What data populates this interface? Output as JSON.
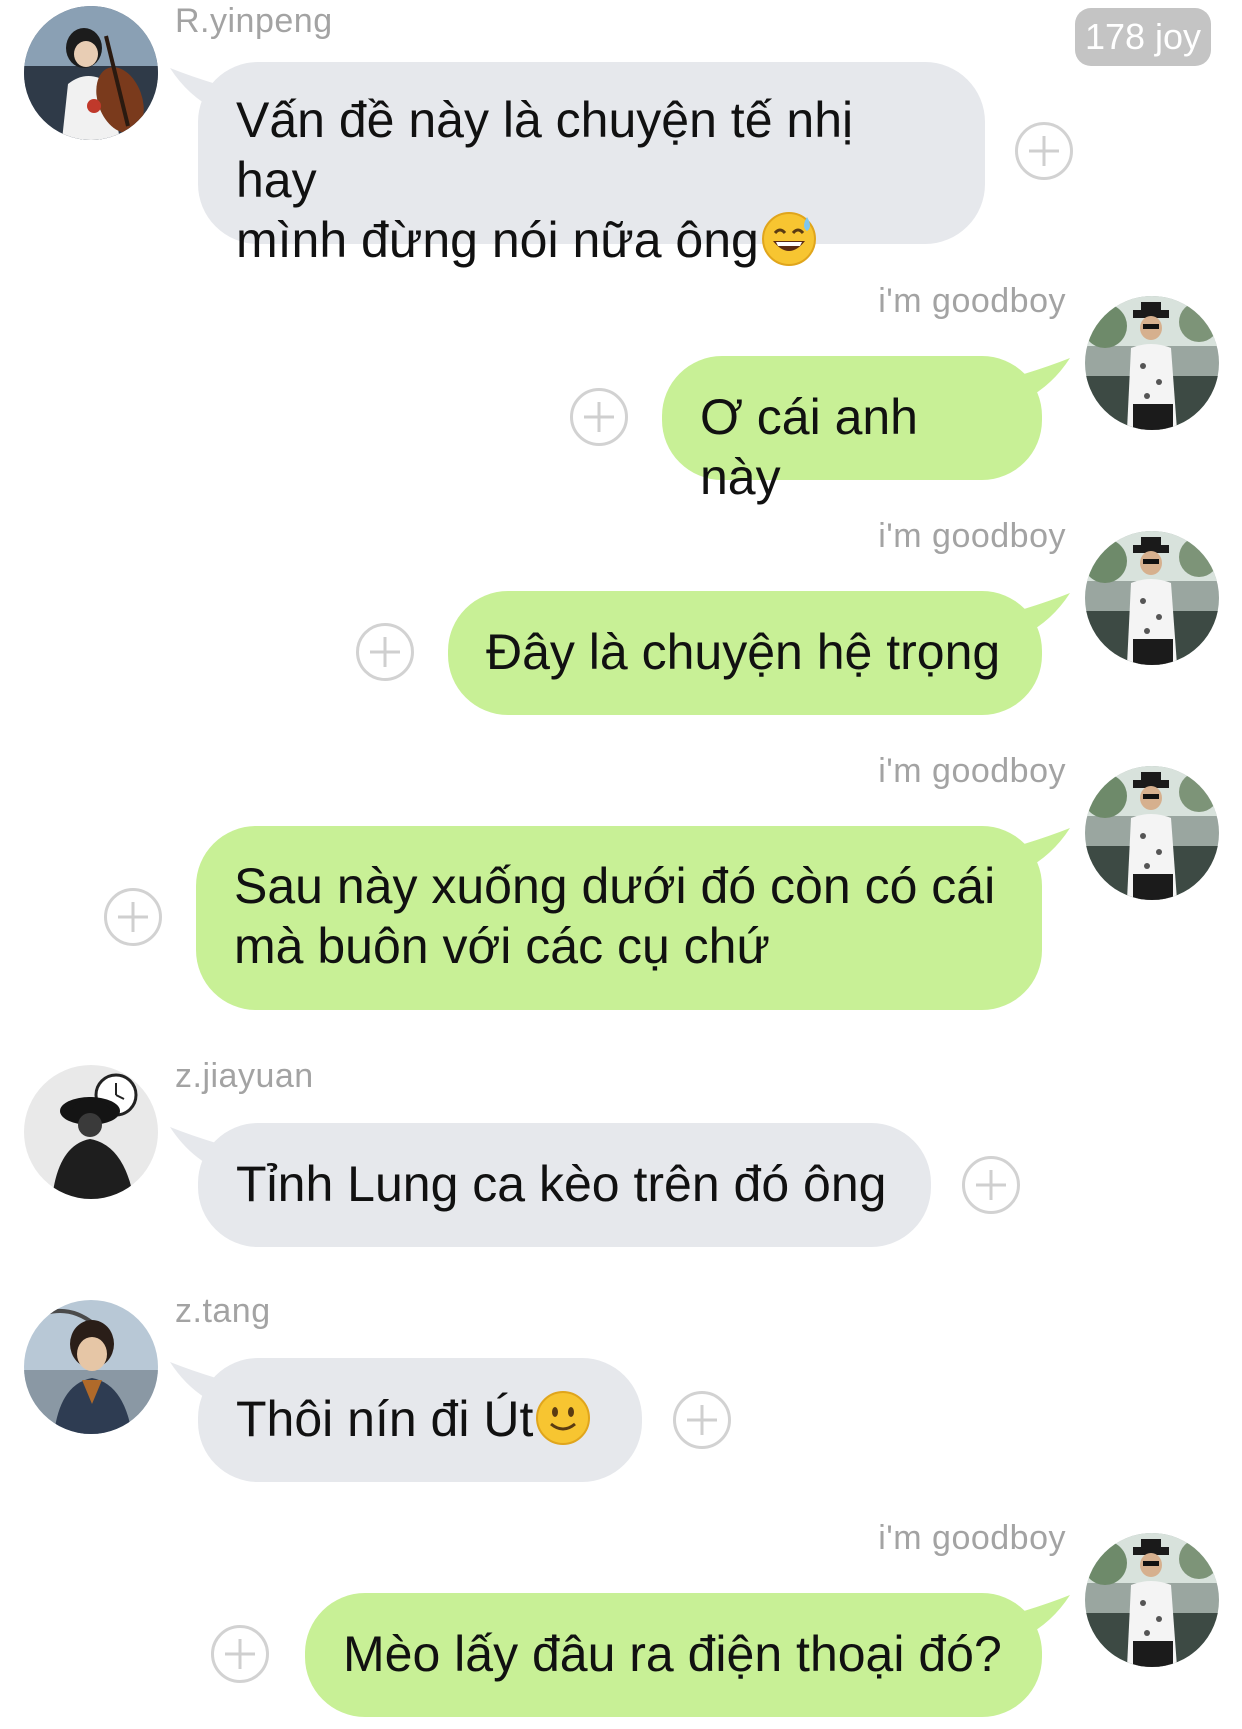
{
  "app": {
    "joy_badge": "178 joy"
  },
  "colors": {
    "incoming_bubble": "#e6e8ec",
    "outgoing_bubble": "#c8f096",
    "sender_name": "#a3a3a3",
    "badge_bg": "#c4c4c4"
  },
  "messages": [
    {
      "direction": "incoming",
      "sender": "R.yinpeng",
      "line1": "Vấn đề này là chuyện tế nhị hay",
      "line2": "mình đừng nói nữa ông",
      "emoji": "sweat-smile-emoji"
    },
    {
      "direction": "outgoing",
      "sender": "i'm goodboy",
      "line1": "Ơ cái anh này"
    },
    {
      "direction": "outgoing",
      "sender": "i'm goodboy",
      "line1": "Đây là chuyện hệ trọng"
    },
    {
      "direction": "outgoing",
      "sender": "i'm goodboy",
      "line1": "Sau này xuống dưới đó còn có cái",
      "line2": "mà buôn với các cụ chứ"
    },
    {
      "direction": "incoming",
      "sender": "z.jiayuan",
      "line1": "Tỉnh Lung ca kèo trên đó ông"
    },
    {
      "direction": "incoming",
      "sender": "z.tang",
      "line1": "Thôi nín đi Út",
      "emoji": "slight-smile-emoji"
    },
    {
      "direction": "outgoing",
      "sender": "i'm goodboy",
      "line1": "Mèo lấy đâu ra điện thoại đó?"
    }
  ]
}
